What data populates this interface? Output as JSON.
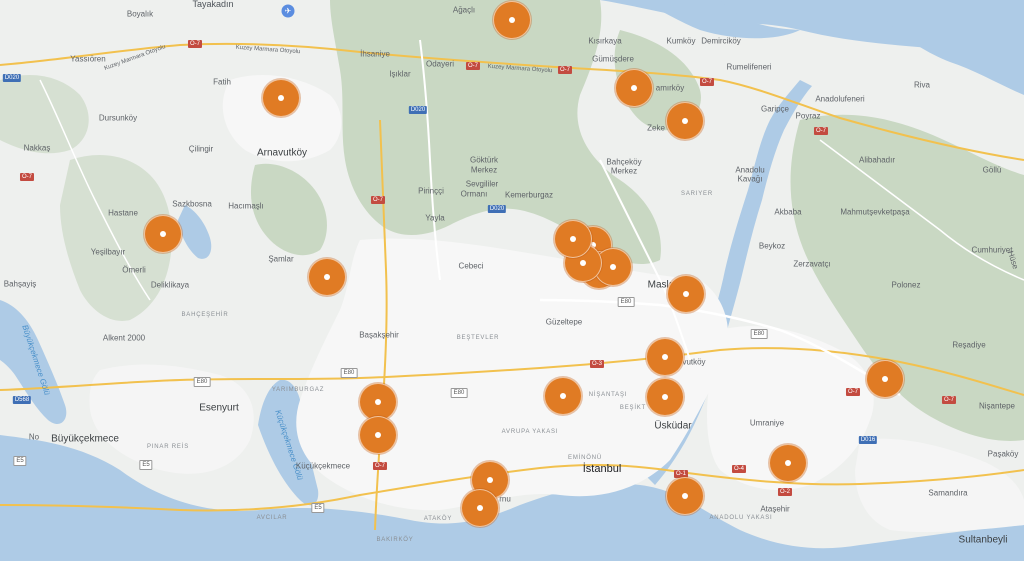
{
  "colors": {
    "marker": "#e07b24",
    "water": "#aecbe6",
    "forest": "#c9d8c3",
    "urban": "#f7f7f7",
    "road": "#ffffff",
    "highway": "#f2c14e"
  },
  "labels": {
    "tayakadin": "Tayakadın",
    "boyalik": "Boyalık",
    "agacli": "Ağaçlı",
    "yassioren": "Yassıören",
    "kuzey_marmara_1": "Kuzey Marmara Otoyolu",
    "kuzey_marmara_2": "Kuzey Marmara Otoyolu",
    "kuzey_marmara_3": "Kuzey Marmara Otoyolu",
    "ihsaniye": "İhsaniye",
    "kisirkaya": "Kısırkaya",
    "kumkoy": "Kumköy",
    "demirciköy": "Demirciköy",
    "odayeri": "Odayeri",
    "isiklar": "Işıklar",
    "gumusdere": "Gümüşdere",
    "rumelifeneri": "Rumelifeneri",
    "fatih": "Fatih",
    "zekeriyakoy_a": "amırköy",
    "anadolufeneri": "Anadolufeneri",
    "riva": "Riva",
    "dursunkoy": "Dursunköy",
    "garipce": "Garipçe",
    "poyraz": "Poyraz",
    "zekeriyakoy_b": "Zeke",
    "nakkas": "Nakkaş",
    "cilingir": "Çilingir",
    "arnavutkoy": "Arnavutköy",
    "gokturk": "Göktürk",
    "merkez1": "Merkez",
    "bahcekoy": "Bahçeköy",
    "merkez2": "Merkez",
    "anadolu_kavagi1": "Anadolu",
    "anadolu_kavagi2": "Kavağı",
    "alibahadir": "Alibahadır",
    "golu": "Göllü",
    "sevgililer1": "Sevgililer",
    "sevgililer2": "Ormanı",
    "pirinççi": "Pirinççi",
    "kemerburgaz": "Kemerburgaz",
    "sariyer": "SARIYER",
    "hastane": "Hastane",
    "sazkbosna": "Sazkbosna",
    "hacimasli": "Hacımaşlı",
    "yayla": "Yayla",
    "akbaba": "Akbaba",
    "mahmutsevketpasa": "Mahmutşevketpaşa",
    "yesilbayir": "Yeşilbayır",
    "beykoz": "Beykoz",
    "cumhuriyet": "Cumhuriyet",
    "samlar": "Şamlar",
    "omerli": "Ömerli",
    "cebeci": "Cebeci",
    "zerzavatci": "Zerzavatçı",
    "huseyinli": "Hüse",
    "bahsayis": "Bahşayiş",
    "delikli": "Deliklikaya",
    "maslak": "Masla",
    "polonez": "Polonez",
    "bahcesehir": "BAHÇEŞEHİR",
    "guzeltepe": "Güzeltepe",
    "buyukcekmece_golu": "Büyükçekmece Gölü",
    "alkent": "Alkent 2000",
    "basaksehir": "Başakşehir",
    "beştevler": "BEŞTEVLER",
    "resadiye": "Reşadiye",
    "levent": "vutköy",
    "yarimburgaz": "YARIMBURGAZ",
    "esenyurt": "Esenyurt",
    "kucukcekmece_golu": "Küçükçekmece Gölü",
    "nisantasi": "NİŞANTAŞI",
    "besiktas": "BEŞİKT",
    "uskudar": "Üsküdar",
    "umraniye": "Umraniye",
    "nisantepe": "Nişantepe",
    "no": "No",
    "buyukcekmece": "Büyükçekmece",
    "pinar_reis": "PINAR REİS",
    "avrupa_yakasi": "AVRUPA YAKASI",
    "eminonu": "EMİNÖNÜ",
    "istanbul": "İstanbul",
    "pasakoy": "Paşaköy",
    "kucukcekmece": "Küçükçekmece",
    "samandira": "Samandıra",
    "bakirkoy_a": "rnu",
    "atasehir": "Ataşehir",
    "avcilar": "AVCILAR",
    "anadolu_yakasi": "ANADOLU YAKASI",
    "atakoy": "ATAKÖY",
    "bakirkoy": "BAKIRKÖY",
    "sultanbeyli": "Sultanbeyli"
  },
  "shields": {
    "o7_a": "O-7",
    "o7_b": "O-7",
    "o7_c": "O-7",
    "o7_d": "O-7",
    "o7_e": "O-7",
    "o7_f": "O-7",
    "o7_g": "O-7",
    "o7_h": "O-7",
    "o7_i": "O-7",
    "o7_j": "O-7",
    "d020_a": "D020",
    "d020_b": "D020",
    "d020_c": "D020",
    "e80_a": "E80",
    "e80_b": "E80",
    "e80_c": "E80",
    "e80_d": "E80",
    "e80_e": "E80",
    "e5_a": "E5",
    "e5_b": "E5",
    "e5_c": "E5",
    "o3": "O-3",
    "o1": "O-1",
    "o4": "O-4",
    "o2": "O-2",
    "d016": "D016",
    "d568": "D568"
  },
  "markers": [
    {
      "id": 1
    },
    {
      "id": 2
    },
    {
      "id": 3
    },
    {
      "id": 4
    },
    {
      "id": 5
    },
    {
      "id": 6
    },
    {
      "id": 7
    },
    {
      "id": 8
    },
    {
      "id": 9
    },
    {
      "id": 10
    },
    {
      "id": 11
    },
    {
      "id": 12
    },
    {
      "id": 13
    },
    {
      "id": 14
    },
    {
      "id": 15
    },
    {
      "id": 16
    },
    {
      "id": 17
    },
    {
      "id": 18
    },
    {
      "id": 19
    },
    {
      "id": 20
    },
    {
      "id": 21
    },
    {
      "id": 22
    },
    {
      "id": 23
    },
    {
      "id": 24
    }
  ]
}
